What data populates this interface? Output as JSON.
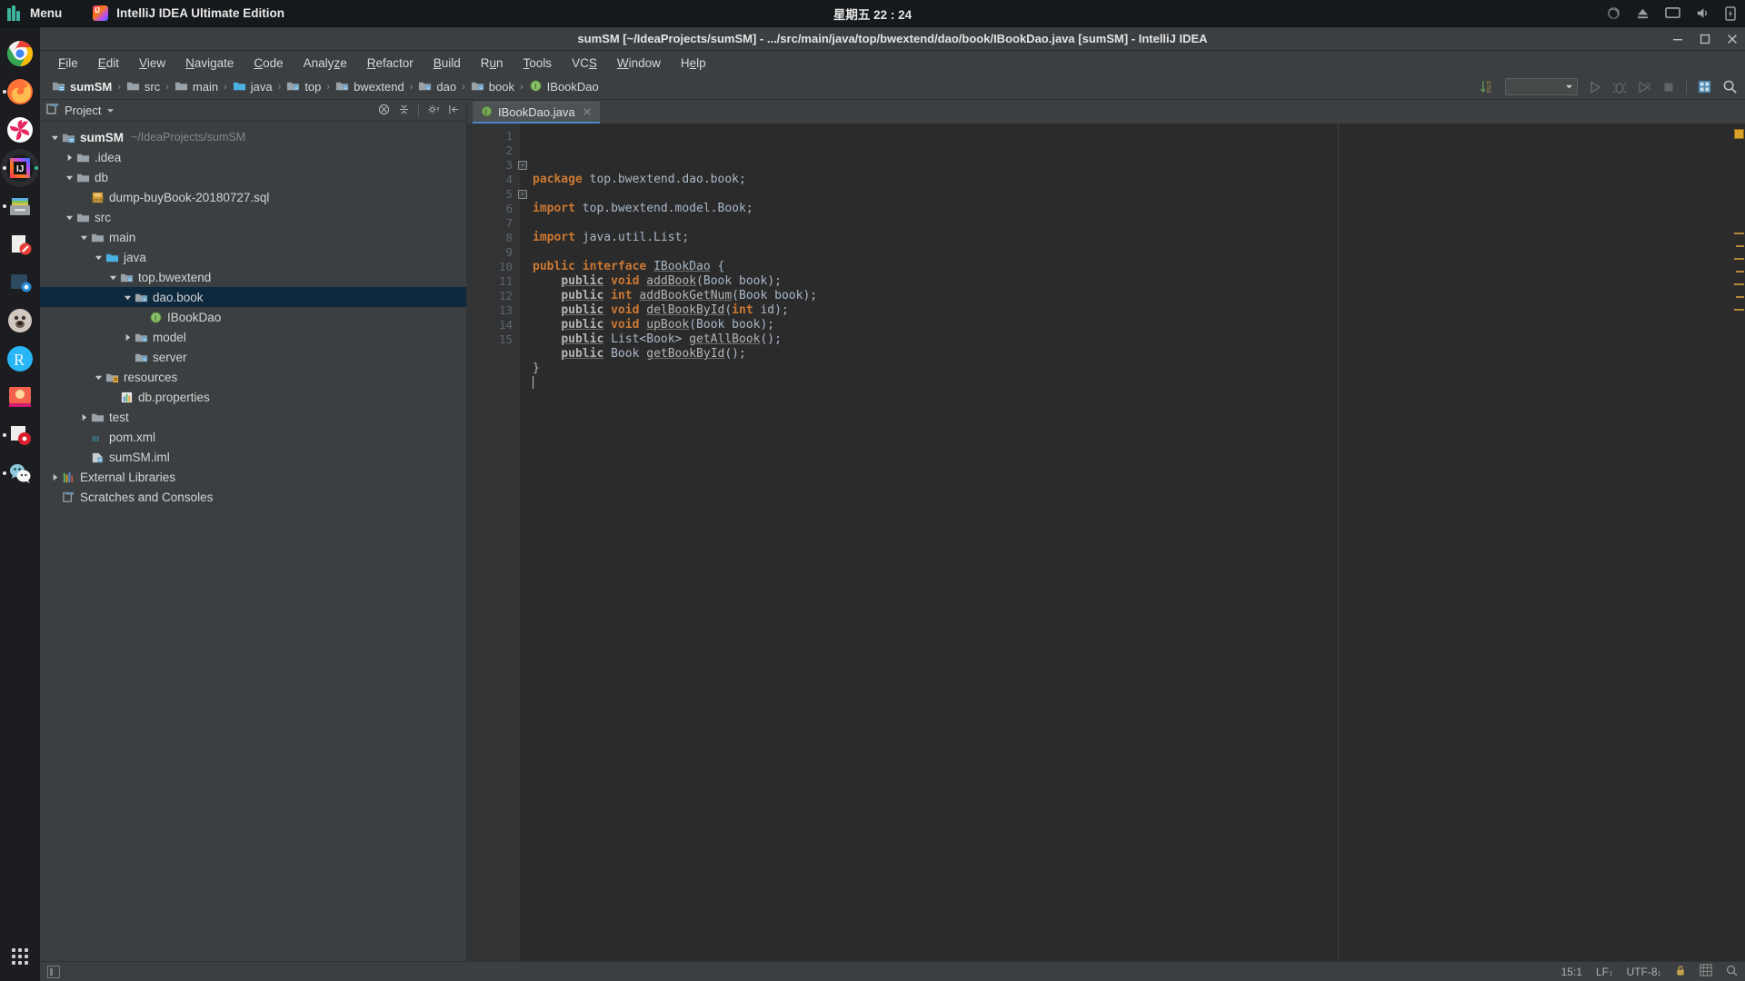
{
  "os_panel": {
    "menu_label": "Menu",
    "menu_icon": "linux-mint-logo",
    "task_label": "IntelliJ IDEA Ultimate Edition",
    "task_icon": "intellij-idea-icon",
    "clock": "星期五 22 : 24",
    "tray": [
      {
        "name": "sync-icon",
        "glyph": "⟳"
      },
      {
        "name": "eject-icon",
        "glyph": "⏏"
      },
      {
        "name": "display-icon",
        "glyph": "▭"
      },
      {
        "name": "volume-icon",
        "glyph": "🔊"
      },
      {
        "name": "battery-icon",
        "glyph": "🔋"
      }
    ]
  },
  "dock": {
    "items": [
      {
        "name": "dock-item-chrome",
        "label": "Google Chrome",
        "color": "#f4f4f4",
        "running": false,
        "active": false
      },
      {
        "name": "dock-item-firefox",
        "label": "Firefox",
        "color": "#e8641c",
        "running": true,
        "active": false
      },
      {
        "name": "dock-item-pinwheel",
        "label": "Pinwheel App",
        "color": "#e8275f",
        "running": false,
        "active": false
      },
      {
        "name": "dock-item-intellij",
        "label": "IntelliJ IDEA",
        "color": "#1d7bff",
        "running": true,
        "active": true
      },
      {
        "name": "dock-item-files",
        "label": "Files",
        "color": "#9aa0a6",
        "running": true,
        "active": false
      },
      {
        "name": "dock-item-notes",
        "label": "Notes",
        "color": "#e8e8e8",
        "running": false,
        "active": false
      },
      {
        "name": "dock-item-screenshot",
        "label": "Screenshot",
        "color": "#2d4a5e",
        "running": false,
        "active": false
      },
      {
        "name": "dock-item-avatar-app",
        "label": "Avatar App",
        "color": "#cfc3bb",
        "running": false,
        "active": false
      },
      {
        "name": "dock-item-r-browser",
        "label": "R Browser",
        "color": "#29b6f6",
        "running": false,
        "active": false
      },
      {
        "name": "dock-item-red-app",
        "label": "Red App",
        "color": "#f4614c",
        "running": false,
        "active": false
      },
      {
        "name": "dock-item-media-player",
        "label": "Media Player",
        "color": "#efefef",
        "running": true,
        "active": false
      },
      {
        "name": "dock-item-wechat",
        "label": "WeChat",
        "color": "#8ec9de",
        "running": true,
        "active": false
      }
    ],
    "apps_grid_label": "Show Applications"
  },
  "ide": {
    "title": "sumSM [~/IdeaProjects/sumSM] - .../src/main/java/top/bwextend/dao/book/IBookDao.java [sumSM] - IntelliJ IDEA",
    "window_controls": [
      {
        "name": "minimize-button",
        "glyph": "—"
      },
      {
        "name": "maximize-button",
        "glyph": "❐"
      },
      {
        "name": "close-button",
        "glyph": "✕"
      }
    ],
    "menu": [
      {
        "name": "menu-file",
        "mnemonic": "F",
        "rest": "ile"
      },
      {
        "name": "menu-edit",
        "mnemonic": "E",
        "rest": "dit"
      },
      {
        "name": "menu-view",
        "mnemonic": "V",
        "rest": "iew"
      },
      {
        "name": "menu-navigate",
        "mnemonic": "N",
        "rest": "avigate"
      },
      {
        "name": "menu-code",
        "mnemonic": "C",
        "rest": "ode"
      },
      {
        "name": "menu-analyze",
        "pre": "Analy",
        "mnemonic": "z",
        "rest": "e"
      },
      {
        "name": "menu-refactor",
        "mnemonic": "R",
        "rest": "efactor"
      },
      {
        "name": "menu-build",
        "mnemonic": "B",
        "rest": "uild"
      },
      {
        "name": "menu-run",
        "pre": "R",
        "mnemonic": "u",
        "rest": "n"
      },
      {
        "name": "menu-tools",
        "mnemonic": "T",
        "rest": "ools"
      },
      {
        "name": "menu-vcs",
        "pre": "VC",
        "mnemonic": "S",
        "rest": ""
      },
      {
        "name": "menu-window",
        "mnemonic": "W",
        "rest": "indow"
      },
      {
        "name": "menu-help",
        "pre": "H",
        "mnemonic": "e",
        "rest": "lp"
      }
    ],
    "breadcrumbs": [
      {
        "name": "breadcrumb-sumSM",
        "label": "sumSM",
        "icon": "project-module-icon"
      },
      {
        "name": "breadcrumb-src",
        "label": "src",
        "icon": "folder-icon"
      },
      {
        "name": "breadcrumb-main",
        "label": "main",
        "icon": "folder-icon"
      },
      {
        "name": "breadcrumb-java",
        "label": "java",
        "icon": "source-folder-icon"
      },
      {
        "name": "breadcrumb-top",
        "label": "top",
        "icon": "package-icon"
      },
      {
        "name": "breadcrumb-bwextend",
        "label": "bwextend",
        "icon": "package-icon"
      },
      {
        "name": "breadcrumb-dao",
        "label": "dao",
        "icon": "package-icon"
      },
      {
        "name": "breadcrumb-book",
        "label": "book",
        "icon": "package-icon"
      },
      {
        "name": "breadcrumb-IBookDao",
        "label": "IBookDao",
        "icon": "interface-icon"
      }
    ],
    "toolbar_right": {
      "run_config_value": "",
      "run_config_placeholder": "",
      "buttons": [
        {
          "name": "compare-icon",
          "label": "Compare",
          "enabled": true
        },
        {
          "name": "run-button",
          "label": "Run",
          "enabled": false
        },
        {
          "name": "debug-button",
          "label": "Debug",
          "enabled": false
        },
        {
          "name": "coverage-button",
          "label": "Run with Coverage",
          "enabled": false
        },
        {
          "name": "stop-button",
          "label": "Stop",
          "enabled": false
        },
        {
          "name": "database-icon",
          "label": "Database",
          "enabled": true
        },
        {
          "name": "search-icon",
          "label": "Search Everywhere",
          "enabled": true
        }
      ]
    }
  },
  "project_panel": {
    "title": "Project",
    "title_icon": "project-view-icon",
    "header_actions": [
      {
        "name": "collapse-all-icon",
        "label": "Collapse All"
      },
      {
        "name": "expand-all-icon",
        "label": "Expand All"
      },
      {
        "name": "settings-gear-icon",
        "label": "Settings"
      },
      {
        "name": "hide-panel-icon",
        "label": "Hide"
      }
    ],
    "tree": [
      {
        "name": "tree-node-sumSM",
        "label": "sumSM",
        "path": "~/IdeaProjects/sumSM",
        "depth": 0,
        "twist": "down",
        "icon": "project-module-icon",
        "bold": true,
        "selected": false
      },
      {
        "name": "tree-node-idea",
        "label": ".idea",
        "path": "",
        "depth": 1,
        "twist": "right",
        "icon": "folder-icon",
        "bold": false,
        "selected": false
      },
      {
        "name": "tree-node-db",
        "label": "db",
        "path": "",
        "depth": 1,
        "twist": "down",
        "icon": "folder-icon",
        "bold": false,
        "selected": false
      },
      {
        "name": "tree-node-dump-sql",
        "label": "dump-buyBook-20180727.sql",
        "path": "",
        "depth": 2,
        "twist": "none",
        "icon": "sql-file-icon",
        "bold": false,
        "selected": false
      },
      {
        "name": "tree-node-src",
        "label": "src",
        "path": "",
        "depth": 1,
        "twist": "down",
        "icon": "folder-icon",
        "bold": false,
        "selected": false
      },
      {
        "name": "tree-node-main",
        "label": "main",
        "path": "",
        "depth": 2,
        "twist": "down",
        "icon": "folder-icon",
        "bold": false,
        "selected": false
      },
      {
        "name": "tree-node-java",
        "label": "java",
        "path": "",
        "depth": 3,
        "twist": "down",
        "icon": "source-folder-icon",
        "bold": false,
        "selected": false
      },
      {
        "name": "tree-node-top-bwextend",
        "label": "top.bwextend",
        "path": "",
        "depth": 4,
        "twist": "down",
        "icon": "package-icon",
        "bold": false,
        "selected": false
      },
      {
        "name": "tree-node-dao-book",
        "label": "dao.book",
        "path": "",
        "depth": 5,
        "twist": "down",
        "icon": "package-icon",
        "bold": false,
        "selected": true
      },
      {
        "name": "tree-node-IBookDao",
        "label": "IBookDao",
        "path": "",
        "depth": 6,
        "twist": "none",
        "icon": "interface-icon",
        "bold": false,
        "selected": false
      },
      {
        "name": "tree-node-model",
        "label": "model",
        "path": "",
        "depth": 5,
        "twist": "right",
        "icon": "package-icon",
        "bold": false,
        "selected": false
      },
      {
        "name": "tree-node-server",
        "label": "server",
        "path": "",
        "depth": 5,
        "twist": "none",
        "icon": "package-icon",
        "bold": false,
        "selected": false
      },
      {
        "name": "tree-node-resources",
        "label": "resources",
        "path": "",
        "depth": 3,
        "twist": "down",
        "icon": "resources-folder-icon",
        "bold": false,
        "selected": false
      },
      {
        "name": "tree-node-db-properties",
        "label": "db.properties",
        "path": "",
        "depth": 4,
        "twist": "none",
        "icon": "properties-file-icon",
        "bold": false,
        "selected": false
      },
      {
        "name": "tree-node-test",
        "label": "test",
        "path": "",
        "depth": 2,
        "twist": "right",
        "icon": "folder-icon",
        "bold": false,
        "selected": false
      },
      {
        "name": "tree-node-pom-xml",
        "label": "pom.xml",
        "path": "",
        "depth": 2,
        "twist": "none",
        "icon": "maven-file-icon",
        "bold": false,
        "selected": false
      },
      {
        "name": "tree-node-sumSM-iml",
        "label": "sumSM.iml",
        "path": "",
        "depth": 2,
        "twist": "none",
        "icon": "iml-file-icon",
        "bold": false,
        "selected": false
      },
      {
        "name": "tree-node-external-libraries",
        "label": "External Libraries",
        "path": "",
        "depth": 0,
        "twist": "right",
        "icon": "libraries-icon",
        "bold": false,
        "selected": false
      },
      {
        "name": "tree-node-scratches",
        "label": "Scratches and Consoles",
        "path": "",
        "depth": 0,
        "twist": "none",
        "icon": "scratches-icon",
        "bold": false,
        "selected": false
      }
    ]
  },
  "editor": {
    "tab": {
      "label": "IBookDao.java",
      "icon": "interface-icon",
      "close_glyph": "✕"
    },
    "lines": [
      {
        "n": 1,
        "fold": "",
        "tokens": [
          {
            "t": "package",
            "c": "kw"
          },
          {
            "t": " top.bwextend.dao.book;",
            "c": "punc"
          }
        ]
      },
      {
        "n": 2,
        "fold": "",
        "tokens": []
      },
      {
        "n": 3,
        "fold": "-",
        "tokens": [
          {
            "t": "import",
            "c": "kw"
          },
          {
            "t": " top.bwextend.model.Book;",
            "c": "punc"
          }
        ]
      },
      {
        "n": 4,
        "fold": "",
        "tokens": []
      },
      {
        "n": 5,
        "fold": "-",
        "tokens": [
          {
            "t": "import",
            "c": "kw"
          },
          {
            "t": " java.util.List;",
            "c": "punc"
          }
        ]
      },
      {
        "n": 6,
        "fold": "",
        "tokens": []
      },
      {
        "n": 7,
        "fold": "",
        "tokens": [
          {
            "t": "public interface ",
            "c": "kw"
          },
          {
            "t": "IBookDao",
            "c": "iface"
          },
          {
            "t": " {",
            "c": "punc"
          }
        ]
      },
      {
        "n": 8,
        "fold": "",
        "tokens": [
          {
            "t": "    ",
            "c": "punc"
          },
          {
            "t": "public",
            "c": "mthkw"
          },
          {
            "t": " ",
            "c": "punc"
          },
          {
            "t": "void",
            "c": "kw"
          },
          {
            "t": " ",
            "c": "punc"
          },
          {
            "t": "addBook",
            "c": "mth"
          },
          {
            "t": "(Book book);",
            "c": "punc"
          }
        ]
      },
      {
        "n": 9,
        "fold": "",
        "tokens": [
          {
            "t": "    ",
            "c": "punc"
          },
          {
            "t": "public",
            "c": "mthkw"
          },
          {
            "t": " ",
            "c": "punc"
          },
          {
            "t": "int",
            "c": "kw"
          },
          {
            "t": " ",
            "c": "punc"
          },
          {
            "t": "addBookGetNum",
            "c": "mth"
          },
          {
            "t": "(Book book);",
            "c": "punc"
          }
        ]
      },
      {
        "n": 10,
        "fold": "",
        "tokens": [
          {
            "t": "    ",
            "c": "punc"
          },
          {
            "t": "public",
            "c": "mthkw"
          },
          {
            "t": " ",
            "c": "punc"
          },
          {
            "t": "void",
            "c": "kw"
          },
          {
            "t": " ",
            "c": "punc"
          },
          {
            "t": "delBookById",
            "c": "mth"
          },
          {
            "t": "(",
            "c": "punc"
          },
          {
            "t": "int",
            "c": "kw"
          },
          {
            "t": " id);",
            "c": "punc"
          }
        ]
      },
      {
        "n": 11,
        "fold": "",
        "tokens": [
          {
            "t": "    ",
            "c": "punc"
          },
          {
            "t": "public",
            "c": "mthkw"
          },
          {
            "t": " ",
            "c": "punc"
          },
          {
            "t": "void",
            "c": "kw"
          },
          {
            "t": " ",
            "c": "punc"
          },
          {
            "t": "upBook",
            "c": "mth"
          },
          {
            "t": "(Book book);",
            "c": "punc"
          }
        ]
      },
      {
        "n": 12,
        "fold": "",
        "tokens": [
          {
            "t": "    ",
            "c": "punc"
          },
          {
            "t": "public",
            "c": "mthkw"
          },
          {
            "t": " List<Book> ",
            "c": "punc"
          },
          {
            "t": "getAllBook",
            "c": "mth"
          },
          {
            "t": "();",
            "c": "punc"
          }
        ]
      },
      {
        "n": 13,
        "fold": "",
        "tokens": [
          {
            "t": "    ",
            "c": "punc"
          },
          {
            "t": "public",
            "c": "mthkw"
          },
          {
            "t": " Book ",
            "c": "punc"
          },
          {
            "t": "getBookById",
            "c": "mth"
          },
          {
            "t": "();",
            "c": "punc"
          }
        ]
      },
      {
        "n": 14,
        "fold": "",
        "tokens": [
          {
            "t": "}",
            "c": "punc"
          }
        ]
      },
      {
        "n": 15,
        "fold": "",
        "tokens": [],
        "caret": true
      }
    ],
    "marker_stripe": {
      "warning_box": true,
      "marks_count": 7
    }
  },
  "status_bar": {
    "left_toggle_label": "Toggle Tool Window Bars",
    "caret_position": "15:1",
    "line_separator": "LF",
    "encoding": "UTF-8",
    "items": [
      {
        "name": "lock-icon",
        "label": "Read-only toggle"
      },
      {
        "name": "inspections-icon",
        "label": "Inspections"
      },
      {
        "name": "search-status-icon",
        "label": "Search"
      }
    ]
  },
  "colors": {
    "ide_bg": "#3c3f41",
    "editor_bg": "#2b2b2b",
    "keyword": "#cc7832",
    "code_text": "#a9b7c6",
    "selection": "#0d293e",
    "tab_underline": "#4a88c7",
    "gutter_bg": "#313335",
    "accent_green": "#3db39e"
  }
}
